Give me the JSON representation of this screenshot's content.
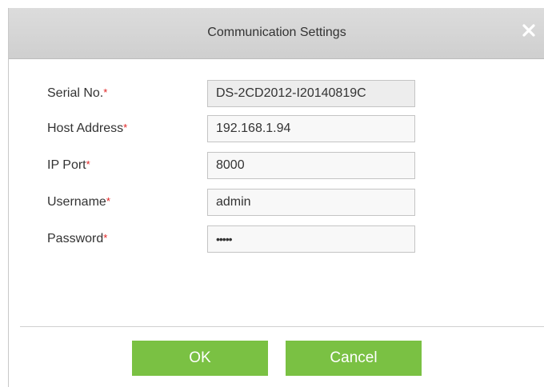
{
  "dialog": {
    "title": "Communication Settings",
    "close_icon": "close-icon"
  },
  "form": {
    "required_marker": "*",
    "fields": [
      {
        "label": "Serial No.",
        "value": "DS-2CD2012-I20140819C"
      },
      {
        "label": "Host Address",
        "value": "192.168.1.94"
      },
      {
        "label": "IP Port",
        "value": "8000"
      },
      {
        "label": "Username",
        "value": "admin"
      },
      {
        "label": "Password",
        "value": "•••••"
      }
    ]
  },
  "buttons": {
    "ok": "OK",
    "cancel": "Cancel"
  },
  "colors": {
    "accent": "#7ac143",
    "required": "#e02020",
    "titlebar": "#d5d5d5"
  }
}
